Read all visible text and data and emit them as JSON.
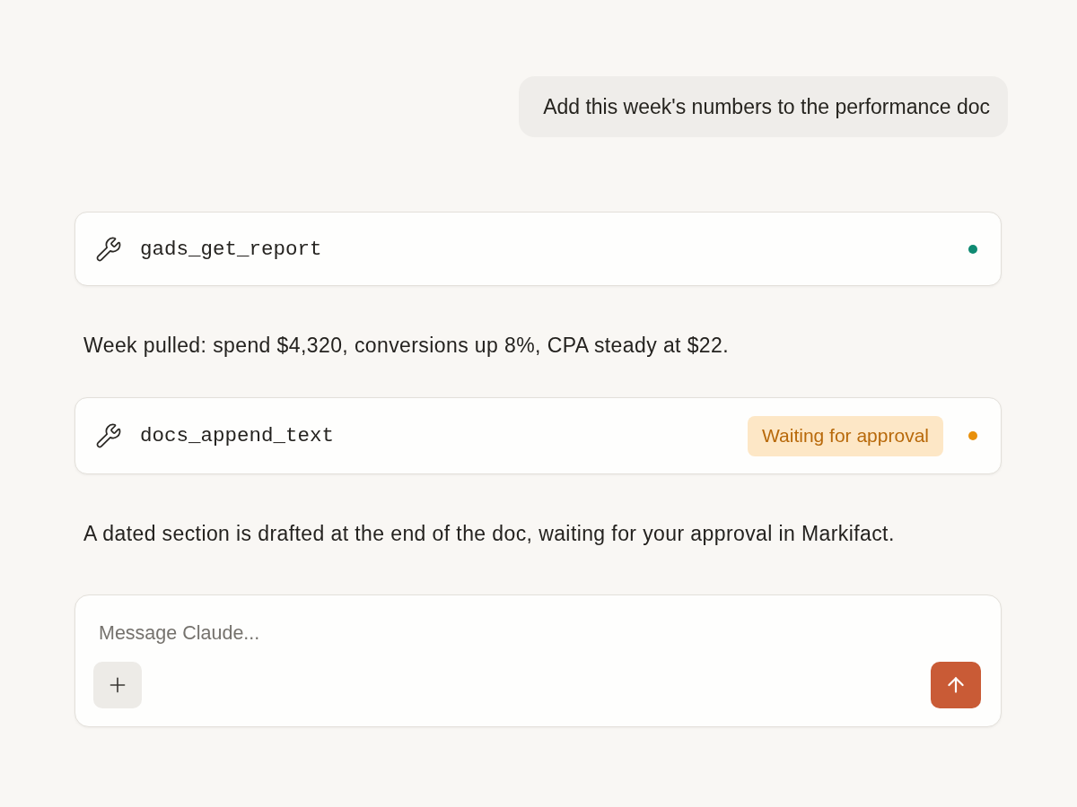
{
  "thread": [
    {
      "kind": "user",
      "text": "Add this week's numbers to the performance doc"
    },
    {
      "kind": "tool",
      "name": "gads_get_report",
      "color": "#0f8a72"
    },
    {
      "kind": "assistant",
      "text": "Week pulled: spend $4,320, conversions up 8%, CPA steady at $22."
    },
    {
      "kind": "tool",
      "name": "docs_append_text",
      "badge": "Waiting for approval",
      "color": "#e8900c"
    },
    {
      "kind": "assistant",
      "text": "A dated section is drafted at the end of the doc, waiting for your approval in Markifact."
    }
  ],
  "composer": {
    "placeholder": "Message Claude..."
  }
}
